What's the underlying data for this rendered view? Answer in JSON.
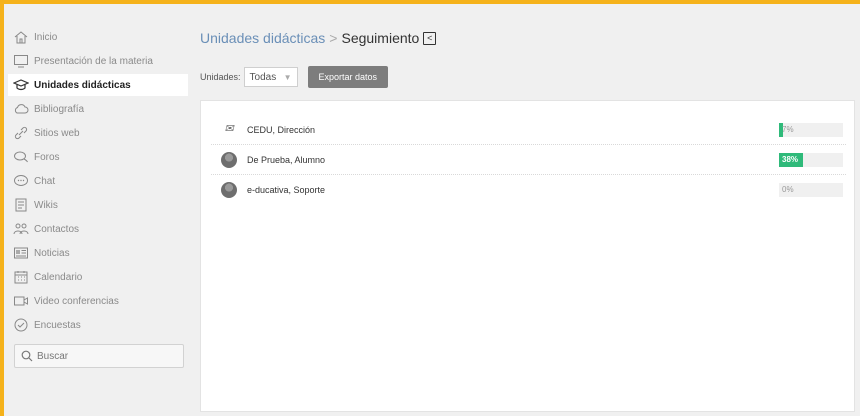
{
  "sidebar": {
    "items": [
      {
        "label": "Inicio",
        "icon": "home-icon",
        "active": false
      },
      {
        "label": "Presentación de la materia",
        "icon": "monitor-icon",
        "active": false
      },
      {
        "label": "Unidades didácticas",
        "icon": "graduation-cap-icon",
        "active": true
      },
      {
        "label": "Bibliografía",
        "icon": "cloud-icon",
        "active": false
      },
      {
        "label": "Sitios web",
        "icon": "link-icon",
        "active": false
      },
      {
        "label": "Foros",
        "icon": "forum-bubbles-icon",
        "active": false
      },
      {
        "label": "Chat",
        "icon": "chat-bubble-icon",
        "active": false
      },
      {
        "label": "Wikis",
        "icon": "wiki-page-icon",
        "active": false
      },
      {
        "label": "Contactos",
        "icon": "contacts-icon",
        "active": false
      },
      {
        "label": "Noticias",
        "icon": "news-icon",
        "active": false
      },
      {
        "label": "Calendario",
        "icon": "calendar-icon",
        "active": false
      },
      {
        "label": "Video conferencias",
        "icon": "video-camera-icon",
        "active": false
      },
      {
        "label": "Encuestas",
        "icon": "survey-icon",
        "active": false
      }
    ],
    "search_label": "Buscar"
  },
  "breadcrumb": {
    "parent": "Unidades didácticas",
    "separator": ">",
    "current": "Seguimiento",
    "back_glyph": "<"
  },
  "filter": {
    "label": "Unidades:",
    "selected": "Todas",
    "caret": "▼",
    "export_label": "Exportar datos"
  },
  "users": [
    {
      "name": "CEDU, Dirección",
      "progress": 7,
      "progress_label": "7%",
      "avatar": "logo"
    },
    {
      "name": "De Prueba, Alumno",
      "progress": 38,
      "progress_label": "38%",
      "avatar": "default-avatar"
    },
    {
      "name": "e-ducativa, Soporte",
      "progress": 0,
      "progress_label": "0%",
      "avatar": "default-avatar"
    }
  ],
  "colors": {
    "accent_border": "#f5b21b",
    "progress_fill": "#2fba7a",
    "link": "#6a8fb7",
    "export_button": "#7d7d7d"
  }
}
